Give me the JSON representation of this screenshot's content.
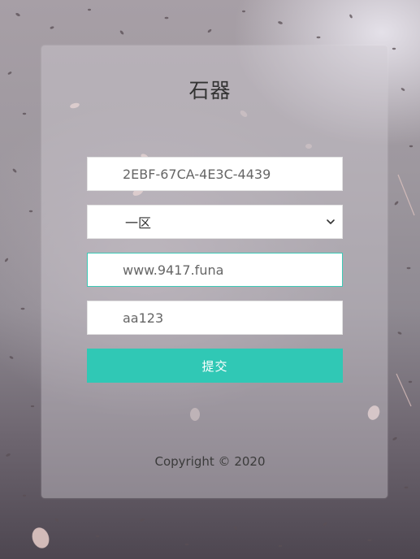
{
  "login": {
    "title": "石器",
    "account_value": "2EBF-67CA-4E3C-4439",
    "server_select": {
      "selected": "一区"
    },
    "site_value": "www.9417.funa",
    "password_value": "aa123",
    "submit_label": "提交"
  },
  "footer": {
    "copyright": "Copyright © 2020"
  },
  "colors": {
    "accent": "#30c8b5",
    "focus_border": "#3cc9b6"
  },
  "icons": {
    "select_arrow": "chevron-down-icon"
  }
}
